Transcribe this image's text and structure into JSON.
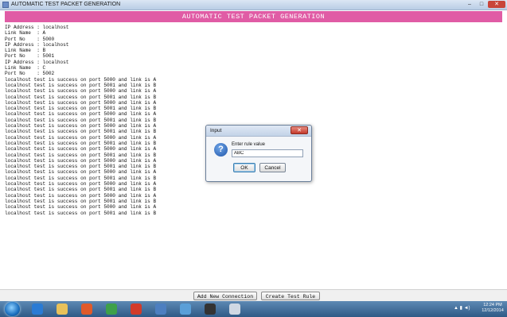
{
  "window": {
    "title": "AUTOMATIC TEST PACKET GENERATION",
    "controls": [
      "–",
      "□",
      "✕"
    ]
  },
  "banner": "AUTOMATIC TEST PACKET GENERATION",
  "log_lines": [
    "IP Address : localhost",
    "Link Name  : A",
    "Port No    : 5000",
    "IP Address : localhost",
    "Link Name  : B",
    "Port No    : 5001",
    "IP Address : localhost",
    "Link Name  : C",
    "Port No    : 5002",
    "localhost test is success on port 5000 and link is A",
    "localhost test is success on port 5001 and link is B",
    "localhost test is success on port 5000 and link is A",
    "localhost test is success on port 5001 and link is B",
    "localhost test is success on port 5000 and link is A",
    "localhost test is success on port 5001 and link is B",
    "localhost test is success on port 5000 and link is A",
    "localhost test is success on port 5001 and link is B",
    "localhost test is success on port 5000 and link is A",
    "localhost test is success on port 5001 and link is B",
    "localhost test is success on port 5000 and link is A",
    "localhost test is success on port 5001 and link is B",
    "localhost test is success on port 5000 and link is A",
    "localhost test is success on port 5001 and link is B",
    "localhost test is success on port 5000 and link is A",
    "localhost test is success on port 5001 and link is B",
    "localhost test is success on port 5000 and link is A",
    "localhost test is success on port 5001 and link is B",
    "localhost test is success on port 5000 and link is A",
    "localhost test is success on port 5001 and link is B",
    "localhost test is success on port 5000 and link is A",
    "localhost test is success on port 5001 and link is B",
    "localhost test is success on port 5000 and link is A",
    "localhost test is success on port 5001 and link is B"
  ],
  "buttons": {
    "add_connection": "Add New Connection",
    "create_rule": "Create Test Rule"
  },
  "dialog": {
    "title": "Input",
    "close": "✕",
    "icon_glyph": "?",
    "prompt": "Enter rule value",
    "input_value": "ABC",
    "ok": "OK",
    "cancel": "Cancel"
  },
  "taskbar": {
    "tray": "▲ ▮ ◄)",
    "time": "12:24 PM",
    "date": "12/12/2014",
    "icon_colors": [
      "#2a7bd4",
      "#e8c15a",
      "#e05a2a",
      "#3ea04a",
      "#d23b2a",
      "#4d7fc0",
      "#5a9fd8",
      "#333333",
      "#cfd8e3"
    ]
  }
}
